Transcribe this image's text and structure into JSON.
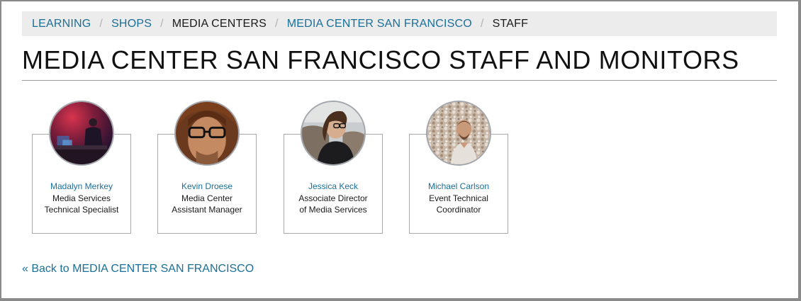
{
  "breadcrumb": [
    {
      "label": "LEARNING",
      "link": true
    },
    {
      "label": "SHOPS",
      "link": true
    },
    {
      "label": "MEDIA CENTERS",
      "link": false
    },
    {
      "label": "MEDIA CENTER SAN FRANCISCO",
      "link": true
    },
    {
      "label": "STAFF",
      "link": false
    }
  ],
  "breadcrumb_separator": "/",
  "page_title": "MEDIA CENTER SAN FRANCISCO STAFF AND MONITORS",
  "staff": [
    {
      "name": "Madalyn Merkey",
      "role_line1": "Media Services",
      "role_line2": "Technical Specialist"
    },
    {
      "name": "Kevin Droese",
      "role_line1": "Media Center",
      "role_line2": "Assistant Manager"
    },
    {
      "name": "Jessica Keck",
      "role_line1": "Associate Director",
      "role_line2": "of Media Services"
    },
    {
      "name": "Michael Carlson",
      "role_line1": "Event Technical",
      "role_line2": "Coordinator"
    }
  ],
  "back_link": "« Back to MEDIA CENTER SAN FRANCISCO",
  "colors": {
    "link": "#1a6f9a",
    "breadcrumb_bg": "#ececec",
    "text": "#111111"
  }
}
